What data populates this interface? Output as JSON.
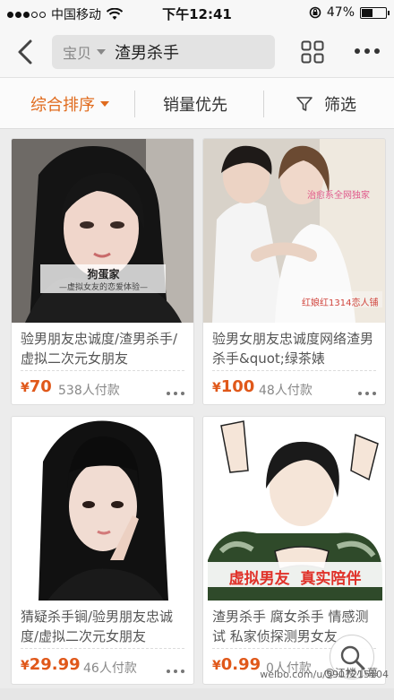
{
  "status_bar": {
    "carrier": "中国移动",
    "time": "下午12:41",
    "battery": "47%",
    "battery_level": 0.47
  },
  "nav": {
    "search_scope": "宝贝",
    "search_query": "渣男杀手"
  },
  "sort_bar": {
    "items": [
      "综合排序",
      "销量优先",
      "筛选"
    ],
    "active_color": "#e06b1d"
  },
  "products": [
    {
      "title": "验男朋友忠诚度/渣男杀手/虚拟二次元女朋友",
      "price": "70",
      "sold": "538人付款",
      "image_caption": "狗蛋家",
      "image_subcaption": "—虚拟女友的恋爱体验—"
    },
    {
      "title": "验男女朋友忠诚度网络渣男杀手&quot;绿茶婊",
      "price": "100",
      "sold": "48人付款",
      "image_caption": "治愈系全网独家",
      "image_subcaption": "红娘红1314恋人铺"
    },
    {
      "title": "猜疑杀手锏/验男朋友忠诚度/虚拟二次元女朋友",
      "price": "29.99",
      "sold": "46人付款"
    },
    {
      "title": "渣男杀手 腐女杀手 情感测试 私家侦探测男女友",
      "price": "0.99",
      "sold": "0人付款",
      "image_caption": "虚拟男友  真实陪伴"
    }
  ],
  "currency_symbol": "¥",
  "colors": {
    "price": "#e0581a",
    "accent": "#e06b1d"
  },
  "watermark": "weibo.com/u/5907215104",
  "watermark_name": "@江楼小幕"
}
